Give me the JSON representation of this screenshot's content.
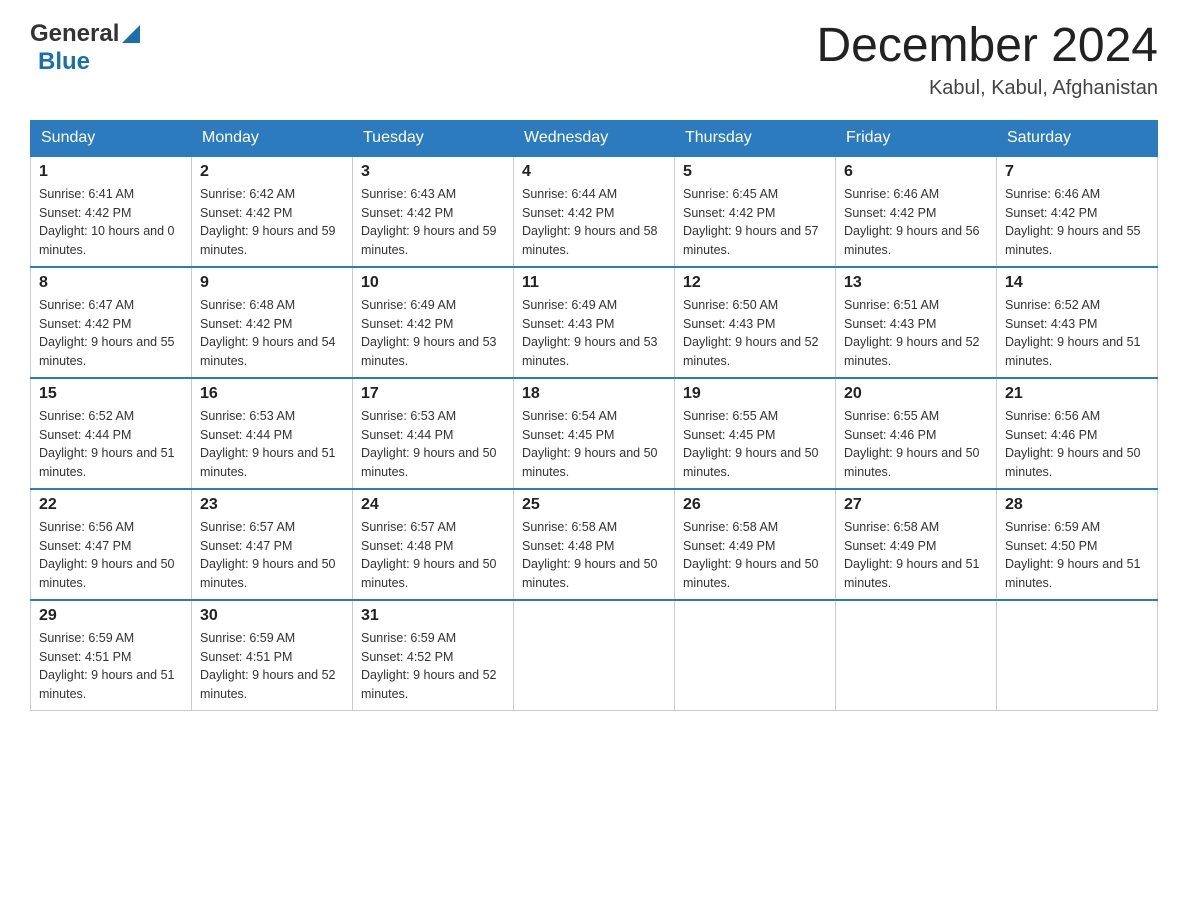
{
  "header": {
    "logo_general": "General",
    "logo_blue": "Blue",
    "month_title": "December 2024",
    "location": "Kabul, Kabul, Afghanistan"
  },
  "days_of_week": [
    "Sunday",
    "Monday",
    "Tuesday",
    "Wednesday",
    "Thursday",
    "Friday",
    "Saturday"
  ],
  "weeks": [
    [
      {
        "day": "1",
        "sunrise": "6:41 AM",
        "sunset": "4:42 PM",
        "daylight": "10 hours and 0 minutes."
      },
      {
        "day": "2",
        "sunrise": "6:42 AM",
        "sunset": "4:42 PM",
        "daylight": "9 hours and 59 minutes."
      },
      {
        "day": "3",
        "sunrise": "6:43 AM",
        "sunset": "4:42 PM",
        "daylight": "9 hours and 59 minutes."
      },
      {
        "day": "4",
        "sunrise": "6:44 AM",
        "sunset": "4:42 PM",
        "daylight": "9 hours and 58 minutes."
      },
      {
        "day": "5",
        "sunrise": "6:45 AM",
        "sunset": "4:42 PM",
        "daylight": "9 hours and 57 minutes."
      },
      {
        "day": "6",
        "sunrise": "6:46 AM",
        "sunset": "4:42 PM",
        "daylight": "9 hours and 56 minutes."
      },
      {
        "day": "7",
        "sunrise": "6:46 AM",
        "sunset": "4:42 PM",
        "daylight": "9 hours and 55 minutes."
      }
    ],
    [
      {
        "day": "8",
        "sunrise": "6:47 AM",
        "sunset": "4:42 PM",
        "daylight": "9 hours and 55 minutes."
      },
      {
        "day": "9",
        "sunrise": "6:48 AM",
        "sunset": "4:42 PM",
        "daylight": "9 hours and 54 minutes."
      },
      {
        "day": "10",
        "sunrise": "6:49 AM",
        "sunset": "4:42 PM",
        "daylight": "9 hours and 53 minutes."
      },
      {
        "day": "11",
        "sunrise": "6:49 AM",
        "sunset": "4:43 PM",
        "daylight": "9 hours and 53 minutes."
      },
      {
        "day": "12",
        "sunrise": "6:50 AM",
        "sunset": "4:43 PM",
        "daylight": "9 hours and 52 minutes."
      },
      {
        "day": "13",
        "sunrise": "6:51 AM",
        "sunset": "4:43 PM",
        "daylight": "9 hours and 52 minutes."
      },
      {
        "day": "14",
        "sunrise": "6:52 AM",
        "sunset": "4:43 PM",
        "daylight": "9 hours and 51 minutes."
      }
    ],
    [
      {
        "day": "15",
        "sunrise": "6:52 AM",
        "sunset": "4:44 PM",
        "daylight": "9 hours and 51 minutes."
      },
      {
        "day": "16",
        "sunrise": "6:53 AM",
        "sunset": "4:44 PM",
        "daylight": "9 hours and 51 minutes."
      },
      {
        "day": "17",
        "sunrise": "6:53 AM",
        "sunset": "4:44 PM",
        "daylight": "9 hours and 50 minutes."
      },
      {
        "day": "18",
        "sunrise": "6:54 AM",
        "sunset": "4:45 PM",
        "daylight": "9 hours and 50 minutes."
      },
      {
        "day": "19",
        "sunrise": "6:55 AM",
        "sunset": "4:45 PM",
        "daylight": "9 hours and 50 minutes."
      },
      {
        "day": "20",
        "sunrise": "6:55 AM",
        "sunset": "4:46 PM",
        "daylight": "9 hours and 50 minutes."
      },
      {
        "day": "21",
        "sunrise": "6:56 AM",
        "sunset": "4:46 PM",
        "daylight": "9 hours and 50 minutes."
      }
    ],
    [
      {
        "day": "22",
        "sunrise": "6:56 AM",
        "sunset": "4:47 PM",
        "daylight": "9 hours and 50 minutes."
      },
      {
        "day": "23",
        "sunrise": "6:57 AM",
        "sunset": "4:47 PM",
        "daylight": "9 hours and 50 minutes."
      },
      {
        "day": "24",
        "sunrise": "6:57 AM",
        "sunset": "4:48 PM",
        "daylight": "9 hours and 50 minutes."
      },
      {
        "day": "25",
        "sunrise": "6:58 AM",
        "sunset": "4:48 PM",
        "daylight": "9 hours and 50 minutes."
      },
      {
        "day": "26",
        "sunrise": "6:58 AM",
        "sunset": "4:49 PM",
        "daylight": "9 hours and 50 minutes."
      },
      {
        "day": "27",
        "sunrise": "6:58 AM",
        "sunset": "4:49 PM",
        "daylight": "9 hours and 51 minutes."
      },
      {
        "day": "28",
        "sunrise": "6:59 AM",
        "sunset": "4:50 PM",
        "daylight": "9 hours and 51 minutes."
      }
    ],
    [
      {
        "day": "29",
        "sunrise": "6:59 AM",
        "sunset": "4:51 PM",
        "daylight": "9 hours and 51 minutes."
      },
      {
        "day": "30",
        "sunrise": "6:59 AM",
        "sunset": "4:51 PM",
        "daylight": "9 hours and 52 minutes."
      },
      {
        "day": "31",
        "sunrise": "6:59 AM",
        "sunset": "4:52 PM",
        "daylight": "9 hours and 52 minutes."
      },
      null,
      null,
      null,
      null
    ]
  ]
}
